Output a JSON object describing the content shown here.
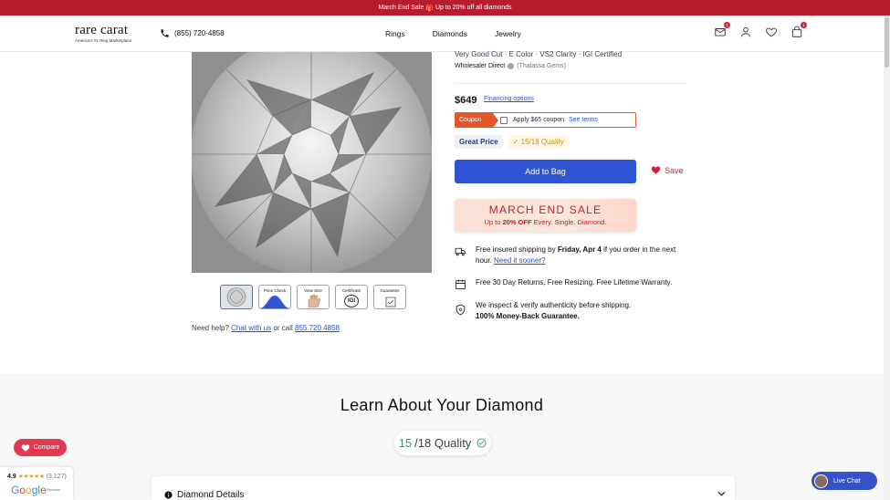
{
  "promo": {
    "text_left": "March End Sale",
    "gift_icon": "gift-icon",
    "text_right": "Up to 20% off all diamonds"
  },
  "header": {
    "brand": "rare carat",
    "tagline": "America's #1 Ring Marketplace",
    "phone": "(855) 720-4858",
    "nav": [
      "Rings",
      "Diamonds",
      "Jewelry"
    ],
    "badges": {
      "mail": "1",
      "bag": "1"
    }
  },
  "product": {
    "specs": "Very Good Cut · E Color · VS2 Clarity · IGI Certified",
    "seller_label": "Wholesaler Direct",
    "seller_name": "(Thalassa Gems)",
    "price": "$649",
    "financing": "Financing options",
    "coupon": {
      "tab": "Coupon",
      "text": "Apply $65 coupon.",
      "link": "See terms"
    },
    "price_pill": "Great Price",
    "quality_pill": "15/18 Quality",
    "add_to_bag": "Add to Bag",
    "save": "Save",
    "sale_title": "MARCH END SALE",
    "sale_sub_pre": "Up to",
    "sale_sub_bold": "20% OFF",
    "sale_sub_post": "Every. Single. Diamond."
  },
  "features": {
    "shipping_pre": "Free insured shipping by",
    "shipping_date": "Friday, Apr 4",
    "shipping_post": "if you order in the next hour.",
    "shipping_link": "Need it sooner?",
    "returns": "Free 30 Day Returns, Free Resizing. Free Lifetime Warranty.",
    "inspect": "We inspect & verify authenticity before shipping.",
    "guarantee": "100% Money-Back Guarantee."
  },
  "thumbs": [
    {
      "label": ""
    },
    {
      "label": "Price Check"
    },
    {
      "label": "View Size"
    },
    {
      "label": "Certificate"
    },
    {
      "label": "Guarantee"
    }
  ],
  "cert_text": "IGI",
  "help": {
    "pre": "Need help?",
    "chat": "Chat with us",
    "mid": "or call",
    "phone": "855.720.4858"
  },
  "learn": {
    "title": "Learn About Your Diamond",
    "quality_num": "15",
    "quality_rest": "/18 Quality",
    "details": "Diamond Details"
  },
  "widgets": {
    "compare": "Compare",
    "rating": "4.9",
    "stars": "★★★★★",
    "review_count": "(3,127)",
    "google": "Google",
    "google_sub": "Reviews",
    "live_chat": "Live Chat"
  },
  "colors": {
    "promo": "#b71c2c",
    "primary": "#2f55d4",
    "accent_red": "#d21f3c",
    "coupon": "#e4572e"
  }
}
